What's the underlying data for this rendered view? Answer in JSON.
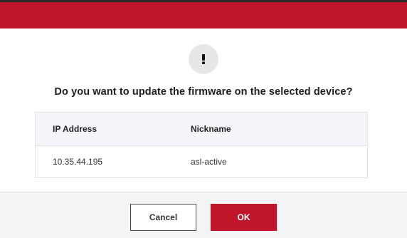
{
  "dialog": {
    "message": "Do you want to update the firmware on the selected device?",
    "icon": "exclamation-icon"
  },
  "table": {
    "headers": [
      "IP Address",
      "Nickname"
    ],
    "rows": [
      {
        "ip": "10.35.44.195",
        "nickname": "asl-active"
      }
    ]
  },
  "buttons": {
    "cancel_label": "Cancel",
    "ok_label": "OK"
  },
  "colors": {
    "brand_red": "#c0152b",
    "header_bg": "#f3f5f8",
    "footer_bg": "#f3f4f6",
    "icon_circle": "#e6e7e9"
  }
}
